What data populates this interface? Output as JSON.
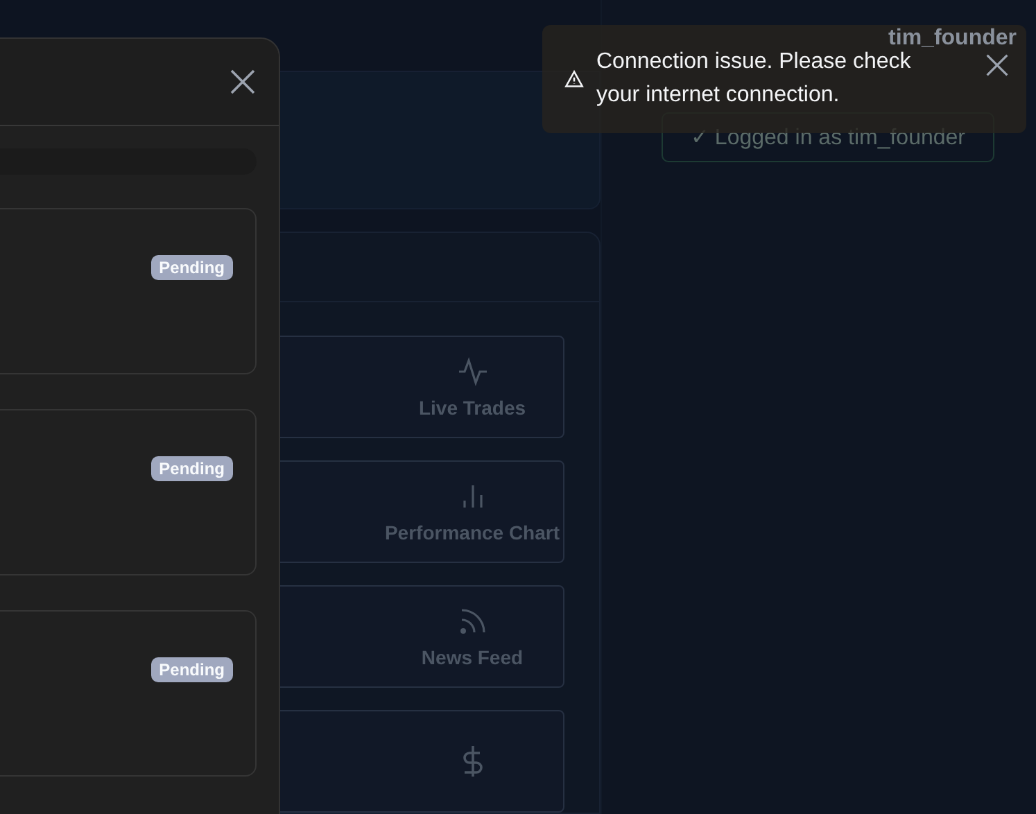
{
  "header": {
    "username": "tim_founder"
  },
  "login_status": {
    "text": "✓ Logged in as tim_founder"
  },
  "tiles": [
    {
      "kind": "activity",
      "label": "Live Trades"
    },
    {
      "kind": "chart",
      "label": "Performance Chart"
    },
    {
      "kind": "feed",
      "label": "News Feed"
    },
    {
      "kind": "dollar"
    }
  ],
  "drawer": {
    "cards": [
      {
        "status": "Pending"
      },
      {
        "status": "Pending"
      },
      {
        "status": "Pending"
      }
    ]
  },
  "toast": {
    "message": "Connection issue. Please check your internet connection."
  }
}
